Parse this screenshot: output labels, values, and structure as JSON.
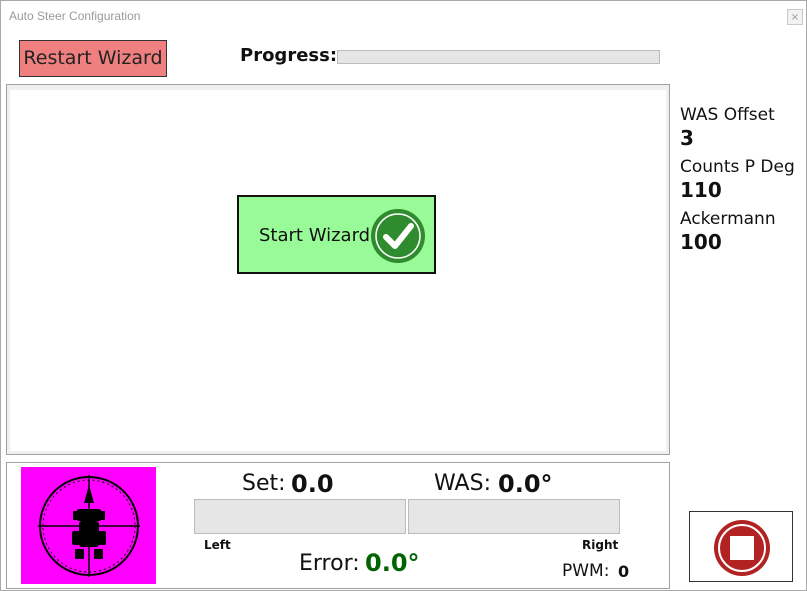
{
  "window": {
    "title": "Auto Steer Configuration",
    "close_glyph": "×"
  },
  "toolbar": {
    "restart_label": "Restart Wizard",
    "progress_label": "Progress:",
    "progress_value": 0
  },
  "wizard": {
    "start_label": "Start Wizard",
    "start_icon": "checkmark-circle-icon"
  },
  "stats": [
    {
      "label": "WAS Offset",
      "value": "3"
    },
    {
      "label": "Counts P Deg",
      "value": "110"
    },
    {
      "label": "Ackermann",
      "value": "100"
    }
  ],
  "steer": {
    "icon": "tractor-compass-icon",
    "set_label": "Set:",
    "set_value": "0.0",
    "was_label": "WAS:",
    "was_value": "0.0°",
    "left_label": "Left",
    "right_label": "Right",
    "error_label": "Error:",
    "error_value": "0.0°",
    "pwm_label": "PWM:",
    "pwm_value": "0"
  },
  "stop": {
    "icon": "stop-icon"
  },
  "colors": {
    "restart_bg": "#f08080",
    "start_bg": "#98fb98",
    "steer_icon_bg": "#ff00ff",
    "error_value": "#006400",
    "stop_red": "#b22222",
    "check_green": "#2e8b2e"
  }
}
